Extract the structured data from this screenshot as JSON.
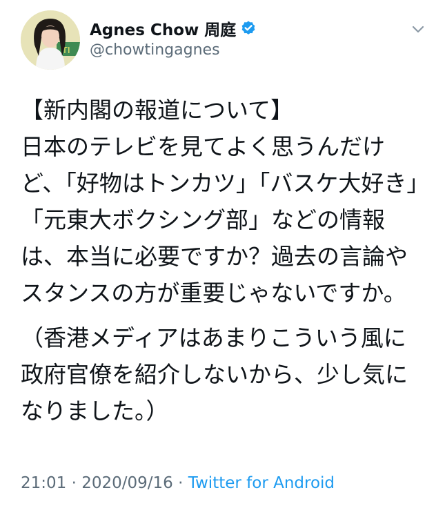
{
  "user": {
    "display_name": "Agnes Chow 周庭",
    "handle": "@chowtingagnes",
    "verified": true
  },
  "icons": {
    "verified": "verified-badge-icon",
    "menu": "chevron-down-icon"
  },
  "tweet": {
    "paragraph_1": "【新内閣の報道について】\n日本のテレビを見てよく思うんだけど、「好物はトンカツ」「バスケ大好き」「元東大ボクシング部」などの情報は、本当に必要ですか？過去の言論やスタンスの方が重要じゃないですか。",
    "paragraph_2": "（香港メディアはあまりこういう風に政府官僚を紹介しないから、少し気になりました。）"
  },
  "meta": {
    "time": "21:01",
    "separator": "·",
    "date": "2020/09/16",
    "source": "Twitter for Android"
  },
  "colors": {
    "text": "#0f1419",
    "secondary": "#5b6b78",
    "link": "#1d9bf0",
    "verified": "#1d9bf0"
  }
}
